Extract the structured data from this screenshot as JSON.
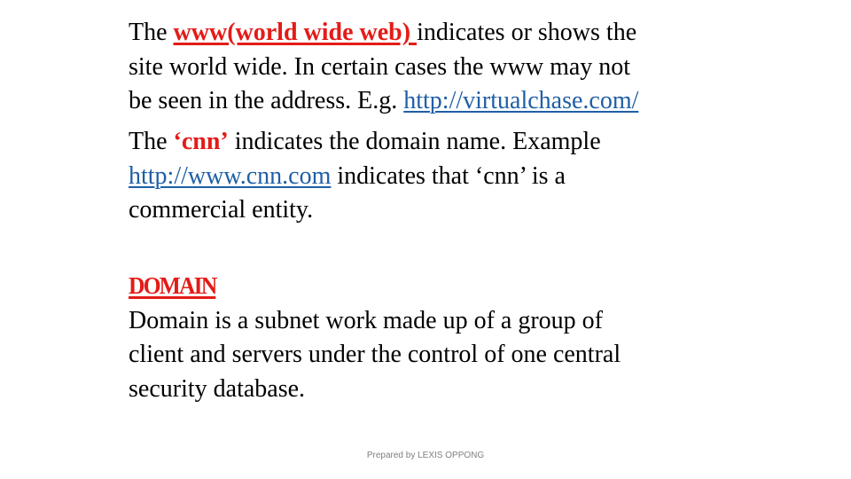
{
  "paragraph1": {
    "lines": [
      {
        "pre": "The ",
        "highlight": "www(world wide web) ",
        "post": "indicates or shows the"
      },
      {
        "text": "site world wide. In certain cases the www may not"
      },
      {
        "pre": "be seen in the address. E.g. ",
        "link": "http://virtualchase.com/"
      }
    ]
  },
  "paragraph2": {
    "lines": [
      {
        "pre": "The ",
        "highlight": "‘cnn’",
        "post": " indicates the domain name. Example"
      },
      {
        "link": "http://www.cnn.com",
        "post": " indicates that ‘cnn’ is a"
      },
      {
        "text": "commercial entity."
      }
    ]
  },
  "section": {
    "heading": "DOMAIN",
    "lines": [
      "Domain is a subnet work made up of a group of",
      "client and servers under the control of one central",
      "security database."
    ]
  },
  "footer": "Prepared by LEXIS OPPONG",
  "colors": {
    "highlight": "#e41b17",
    "link": "#1f5fa6",
    "footer": "#7f7f7f"
  }
}
